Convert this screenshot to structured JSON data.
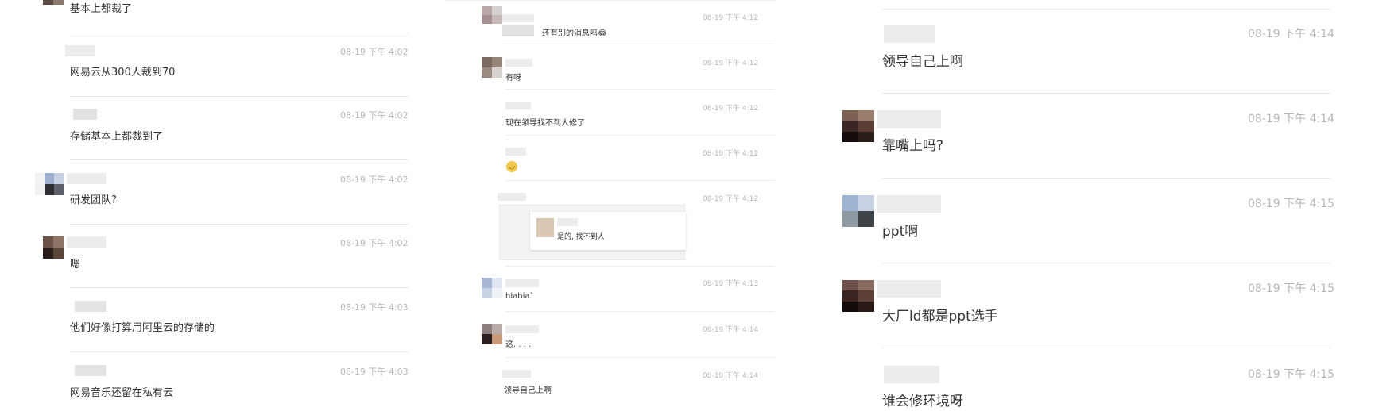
{
  "colors": {
    "divider": "#e6e6e6",
    "time": "#b7b7b7",
    "text": "#333333",
    "name_blur": "#ececec"
  },
  "col1": {
    "messages": [
      {
        "time": "",
        "text": "基本上都裁了"
      },
      {
        "time": "08-19 下午 4:02",
        "text": "网易云从300人裁到70"
      },
      {
        "time": "08-19 下午 4:02",
        "text": "存储基本上都裁到了"
      },
      {
        "time": "08-19 下午 4:02",
        "text": "研发团队?"
      },
      {
        "time": "08-19 下午 4:02",
        "text": "嗯"
      },
      {
        "time": "08-19 下午 4:03",
        "text": "他们好像打算用阿里云的存储的"
      },
      {
        "time": "08-19 下午 4:03",
        "text": "网易音乐还留在私有云"
      }
    ]
  },
  "col2": {
    "messages": [
      {
        "time": "08-19 下午 4:12",
        "text": "还有别的消息吗😂"
      },
      {
        "time": "08-19 下午 4:12",
        "text": "有呀"
      },
      {
        "time": "08-19 下午 4:12",
        "text": "现在领导找不到人修了"
      },
      {
        "time": "08-19 下午 4:12",
        "text": ""
      },
      {
        "time": "08-19 下午 4:12",
        "text": "",
        "quote_text": "是的, 找不到人"
      },
      {
        "time": "08-19 下午 4:13",
        "text": "hiahia`"
      },
      {
        "time": "08-19 下午 4:14",
        "text": "这. . . ."
      },
      {
        "time": "08-19 下午 4:14",
        "text": "领导自己上啊"
      }
    ]
  },
  "col3": {
    "messages": [
      {
        "time": "08-19 下午 4:14",
        "text": "领导自己上啊"
      },
      {
        "time": "08-19 下午 4:14",
        "text": "靠嘴上吗?"
      },
      {
        "time": "08-19 下午 4:15",
        "text": "ppt啊"
      },
      {
        "time": "08-19 下午 4:15",
        "text": "大厂ld都是ppt选手"
      },
      {
        "time": "08-19 下午 4:15",
        "text": "谁会修环境呀"
      }
    ]
  }
}
